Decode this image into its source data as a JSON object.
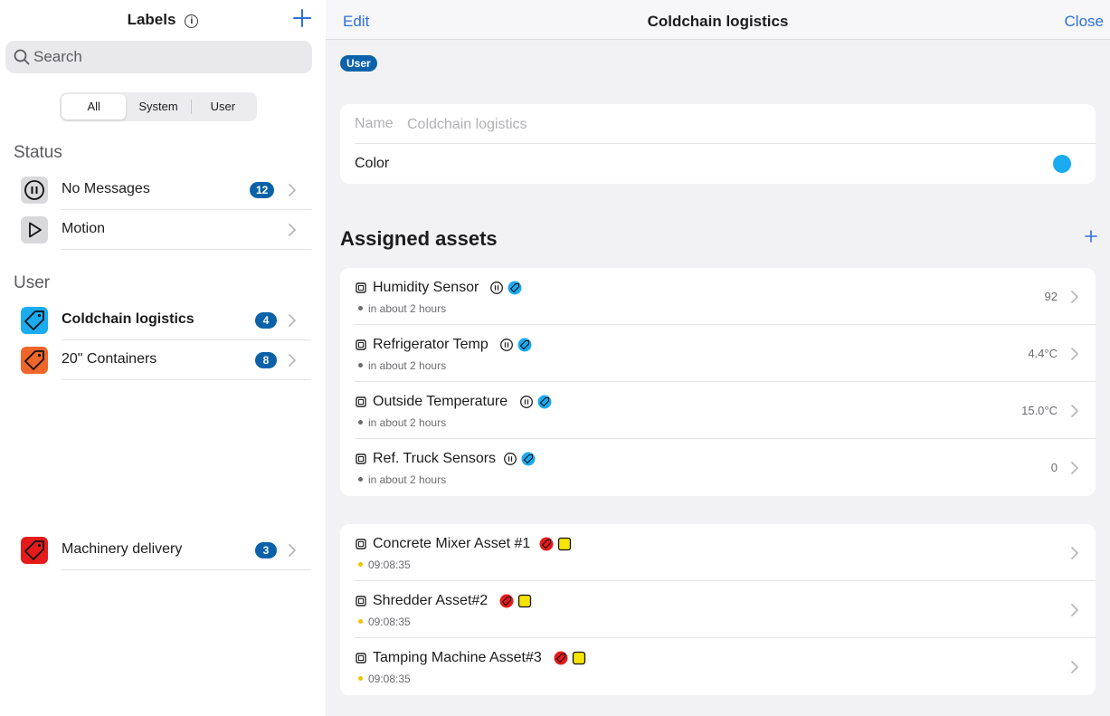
{
  "sidebar": {
    "title": "Labels",
    "search_placeholder": "Search",
    "segments": [
      "All",
      "System",
      "User"
    ],
    "status_header": "Status",
    "user_header": "User",
    "status_items": [
      {
        "label": "No Messages",
        "badge": "12",
        "icon": "pause-circle-icon"
      },
      {
        "label": "Motion",
        "badge": "",
        "icon": "play-icon"
      }
    ],
    "user_items": [
      {
        "label": "Coldchain logistics",
        "badge": "4",
        "icon": "tag-icon",
        "color": "#1aabf0"
      },
      {
        "label": "20\" Containers",
        "badge": "8",
        "icon": "tag-icon",
        "color": "#f0652a"
      },
      {
        "label": "Machinery delivery",
        "badge": "3",
        "icon": "tag-icon",
        "color": "#e51b1b"
      }
    ]
  },
  "main": {
    "edit_label": "Edit",
    "title": "Coldchain logistics",
    "close_label": "Close",
    "tag": "User",
    "form": {
      "name_label": "Name",
      "name_value": "Coldchain logistics",
      "color_label": "Color",
      "color_value": "#1aabf0"
    },
    "assets_header": "Assigned assets",
    "group1": [
      {
        "name": "Humidity Sensor",
        "sub": "in about 2 hours",
        "value": "92"
      },
      {
        "name": "Refrigerator Temp",
        "sub": "in about 2 hours",
        "value": "4.4°C"
      },
      {
        "name": "Outside Temperature",
        "sub": "in about 2 hours",
        "value": "15.0°C"
      },
      {
        "name": "Ref. Truck Sensors",
        "sub": "in about 2 hours",
        "value": "0"
      }
    ],
    "group2": [
      {
        "name": "Concrete Mixer Asset #1",
        "sub": "09:08:35",
        "value": ""
      },
      {
        "name": "Shredder Asset#2",
        "sub": "09:08:35",
        "value": ""
      },
      {
        "name": "Tamping Machine Asset#3",
        "sub": "09:08:35",
        "value": ""
      }
    ]
  },
  "colors": {
    "accent": "#2c6fdb",
    "badge": "#0c62a8",
    "status_gray": "#6b6b70",
    "status_yellow": "#f2c200",
    "tag_blue": "#1aabf0",
    "tag_red": "#e51b1b",
    "tag_yellow": "#f5e400"
  }
}
